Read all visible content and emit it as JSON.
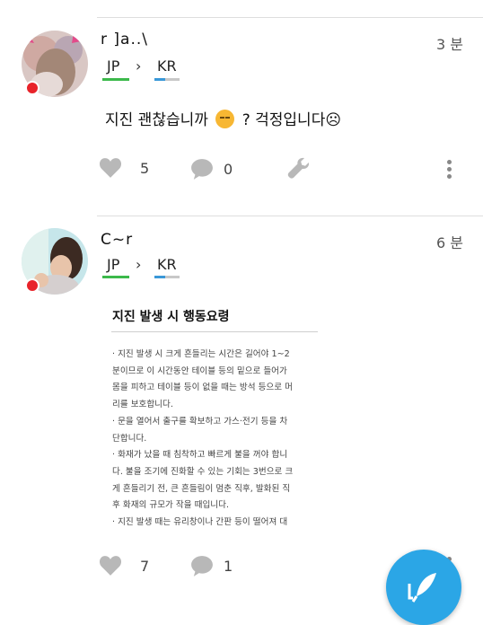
{
  "posts": [
    {
      "username": "r ]a..\\",
      "time": "3 분",
      "lang_from": "JP",
      "lang_to": "KR",
      "text_before": "지진 괜찮습니까",
      "text_after": "? 걱정입니다☹",
      "likes": "5",
      "comments": "0"
    },
    {
      "username": "C~r",
      "time": "6 분",
      "lang_from": "JP",
      "lang_to": "KR",
      "likes": "7",
      "comments": "1",
      "image": {
        "title": "지진 발생 시 행동요령",
        "lines": [
          "· 지진 발생 시 크게 흔들리는 시간은 길어야 1~2",
          "분이므로 이 시간동안 테이블 등의 밑으로 들어가",
          "몸을 피하고 테이블 등이 없을 때는 방석 등으로 머",
          "리를 보호합니다.",
          "· 문을 열어서 출구를 확보하고 가스·전기 등을 차",
          "단합니다.",
          "· 화재가 났을 때 침착하고 빠르게 불을 꺼야 합니",
          "다. 불을 조기에 진화할 수 있는 기회는 3번으로 크",
          "게 흔들리기 전, 큰 흔들림이 멈춘 직후, 발화된 직",
          "후 화재의 규모가 작을 때입니다.",
          "· 지진 발생 때는 유리창이나 간판 등이 떨어져 대"
        ]
      }
    }
  ],
  "colors": {
    "accent_blue": "#2ba6e6",
    "online_red": "#e8232a",
    "lang_green": "#3cb94b"
  },
  "icons": [
    "heart-icon",
    "comment-icon",
    "wrench-icon",
    "more-vertical-icon",
    "feather-pen-icon"
  ]
}
